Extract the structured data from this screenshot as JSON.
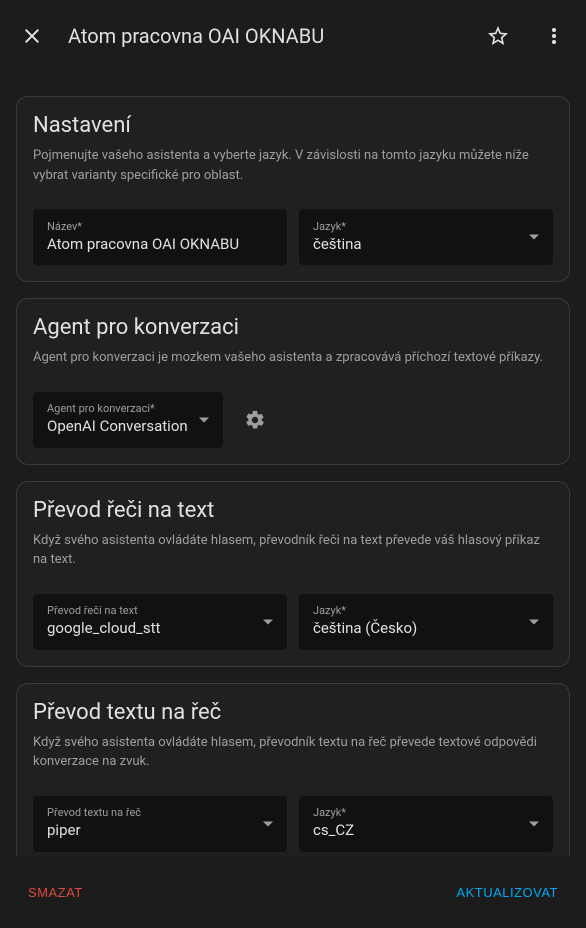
{
  "header": {
    "title": "Atom pracovna OAI OKNABU"
  },
  "sections": {
    "settings": {
      "title": "Nastavení",
      "desc": "Pojmenujte vašeho asistenta a vyberte jazyk. V závislosti na tomto jazyku můžete níže vybrat varianty specifické pro oblast.",
      "name_label": "Název*",
      "name_value": "Atom pracovna OAI OKNABU",
      "lang_label": "Jazyk*",
      "lang_value": "čeština"
    },
    "agent": {
      "title": "Agent pro konverzaci",
      "desc": "Agent pro konverzaci je mozkem vašeho asistenta a zpracovává příchozí textové příkazy.",
      "agent_label": "Agent pro konverzaci*",
      "agent_value": "OpenAI Conversation"
    },
    "stt": {
      "title": "Převod řeči na text",
      "desc": "Když svého asistenta ovládáte hlasem, převodník řeči na text převede váš hlasový příkaz na text.",
      "engine_label": "Převod řeči na text",
      "engine_value": "google_cloud_stt",
      "lang_label": "Jazyk*",
      "lang_value": "čeština (Česko)"
    },
    "tts": {
      "title": "Převod textu na řeč",
      "desc": "Když svého asistenta ovládáte hlasem, převodník textu na řeč převede textové odpovědi konverzace na zvuk.",
      "engine_label": "Převod textu na řeč",
      "engine_value": "piper",
      "lang_label": "Jazyk*",
      "lang_value": "cs_CZ"
    }
  },
  "footer": {
    "delete": "SMAZAT",
    "update": "AKTUALIZOVAT"
  }
}
